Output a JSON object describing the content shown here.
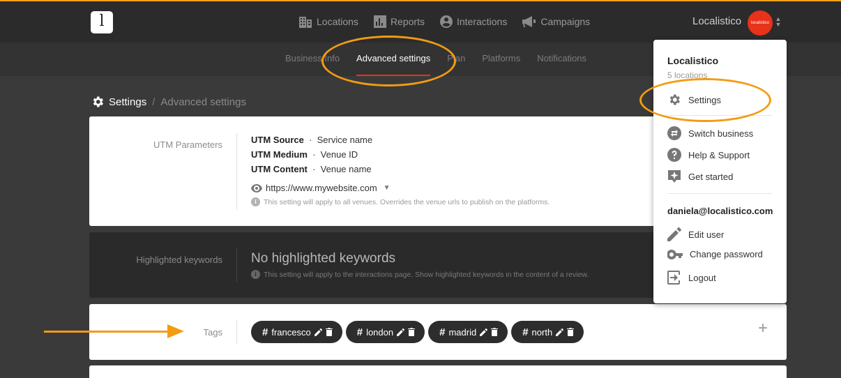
{
  "header": {
    "logo_letter": "l",
    "nav": [
      {
        "label": "Locations",
        "icon": "building-icon"
      },
      {
        "label": "Reports",
        "icon": "bar-chart-icon"
      },
      {
        "label": "Interactions",
        "icon": "person-circle-icon"
      },
      {
        "label": "Campaigns",
        "icon": "megaphone-icon"
      }
    ],
    "business_name": "Localistico",
    "avatar_text": "localistico"
  },
  "subnav": {
    "tabs": [
      "Business Info",
      "Advanced settings",
      "Plan",
      "Platforms",
      "Notifications"
    ],
    "active": "Advanced settings"
  },
  "breadcrumb": {
    "root": "Settings",
    "separator": "/",
    "current": "Advanced settings"
  },
  "utm": {
    "label": "UTM Parameters",
    "rows": [
      {
        "key": "UTM Source",
        "value": "Service name"
      },
      {
        "key": "UTM Medium",
        "value": "Venue ID"
      },
      {
        "key": "UTM Content",
        "value": "Venue name"
      }
    ],
    "url": "https://www.mywebsite.com",
    "hint": "This setting will apply to all venues. Overrides the venue urls to publish on the platforms."
  },
  "keywords": {
    "label": "Highlighted keywords",
    "empty_text": "No highlighted keywords",
    "hint": "This setting will apply to the interactions page. Show highlighted keywords in the content of a review."
  },
  "tags": {
    "label": "Tags",
    "items": [
      "francesco",
      "london",
      "madrid",
      "north"
    ],
    "add_symbol": "+"
  },
  "dropdown": {
    "business": "Localistico",
    "locations": "5 locations",
    "items": [
      {
        "label": "Settings",
        "icon": "gear-icon"
      },
      {
        "label": "Switch business",
        "icon": "switch-icon"
      },
      {
        "label": "Help & Support",
        "icon": "help-icon"
      },
      {
        "label": "Get started",
        "icon": "sparkle-icon"
      }
    ],
    "email": "daniela@localistico.com",
    "user_items": [
      {
        "label": "Edit user",
        "icon": "pencil-icon"
      },
      {
        "label": "Change password",
        "icon": "key-icon"
      },
      {
        "label": "Logout",
        "icon": "logout-icon"
      }
    ]
  },
  "colors": {
    "accent": "#e8321a",
    "annotation": "#f39c12",
    "topbar_border": "#f3a21c"
  }
}
